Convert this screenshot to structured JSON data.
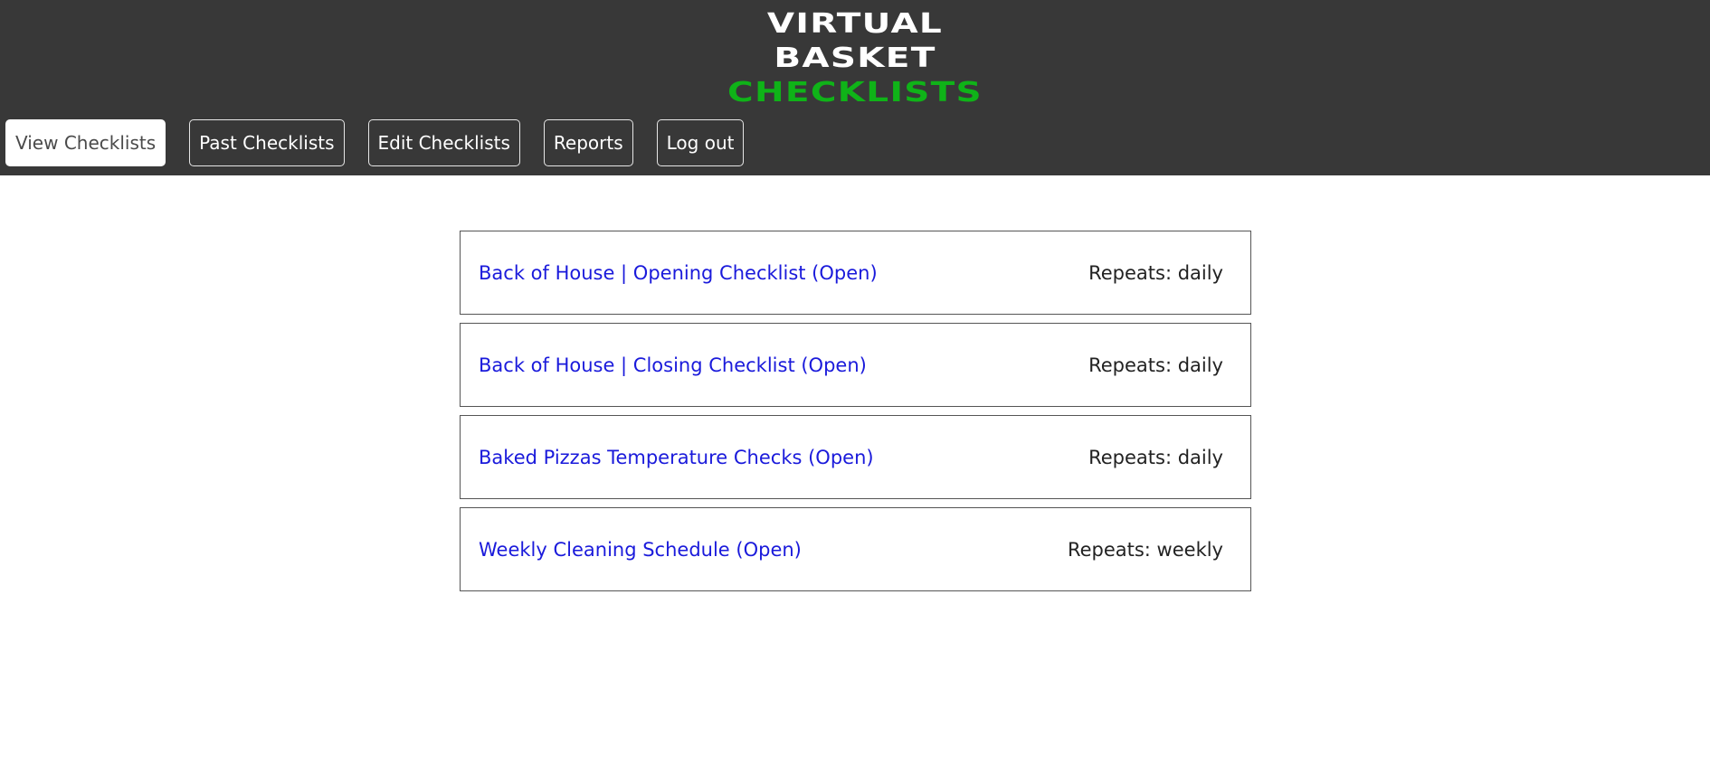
{
  "logo": {
    "line1": "VIRTUAL",
    "line2": "BASKET",
    "line3": "CHECKLISTS"
  },
  "nav": {
    "items": [
      {
        "label": "View Checklists",
        "active": true
      },
      {
        "label": "Past Checklists",
        "active": false
      },
      {
        "label": "Edit Checklists",
        "active": false
      },
      {
        "label": "Reports",
        "active": false
      },
      {
        "label": "Log out",
        "active": false
      }
    ]
  },
  "checklists": [
    {
      "title": "Back of House | Opening Checklist (Open)",
      "repeats": "Repeats: daily"
    },
    {
      "title": "Back of House | Closing Checklist (Open)",
      "repeats": "Repeats: daily"
    },
    {
      "title": "Baked Pizzas Temperature Checks (Open)",
      "repeats": "Repeats: daily"
    },
    {
      "title": "Weekly Cleaning Schedule (Open)",
      "repeats": "Repeats: weekly"
    }
  ],
  "colors": {
    "header_bg": "#383838",
    "logo_accent": "#0fb318",
    "link": "#1a1adb"
  }
}
